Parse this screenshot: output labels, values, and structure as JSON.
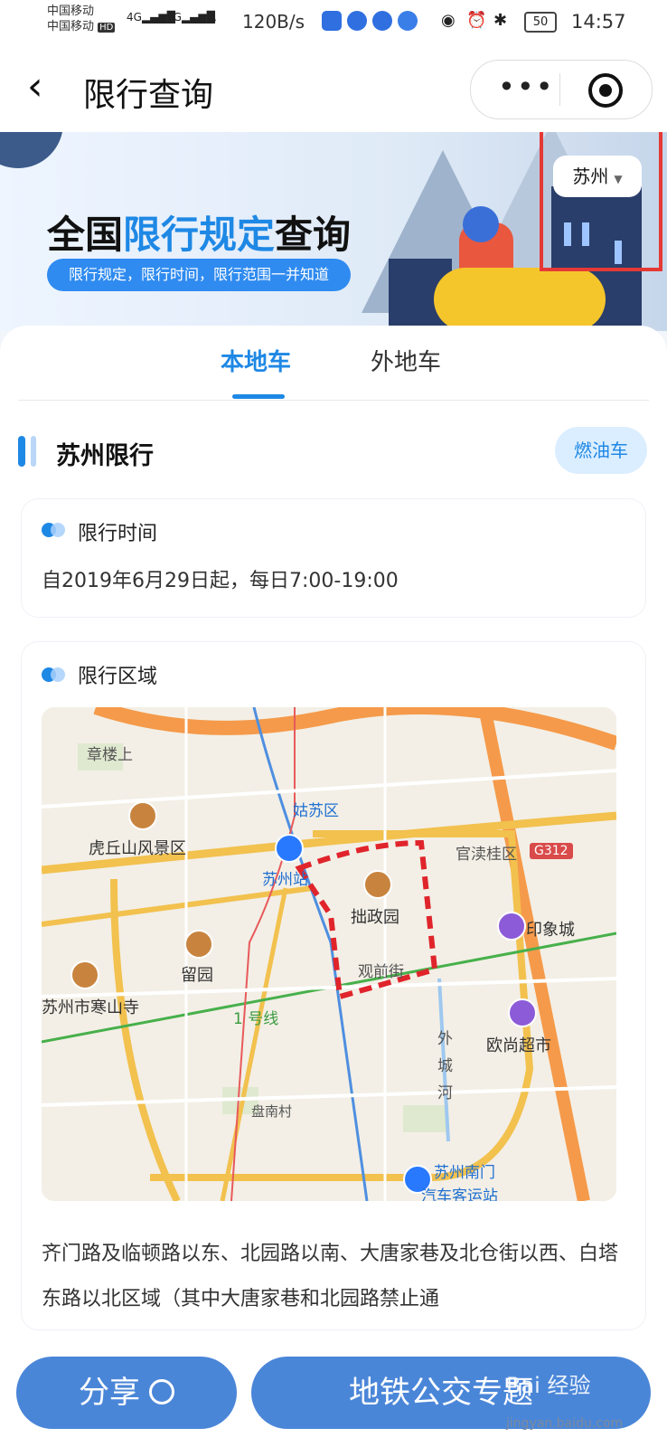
{
  "status_bar": {
    "carrier_1": "中国移动",
    "carrier_2": "中国移动",
    "hd": "HD",
    "net_1": "4G",
    "net_2": "4G",
    "speed": "120B/s",
    "battery": "50",
    "time": "14:57"
  },
  "nav": {
    "title": "限行查询",
    "back_icon": "chevron-left",
    "more_icon": "more-dots",
    "target_icon": "target"
  },
  "banner": {
    "title_part1": "全国",
    "title_highlight": "限行规定",
    "title_part2": "查询",
    "subtitle": "限行规定，限行时间，限行范围一并知道",
    "city": "苏州"
  },
  "tabs": [
    {
      "label": "本地车",
      "active": true
    },
    {
      "label": "外地车",
      "active": false
    }
  ],
  "section": {
    "title": "苏州限行",
    "fuel_label": "燃油车"
  },
  "time_box": {
    "title": "限行时间",
    "text": "自2019年6月29日起，每日7:00-19:00"
  },
  "region_box": {
    "title": "限行区域",
    "text": "齐门路及临顿路以东、北园路以南、大唐家巷及北仓街以西、白塔东路以北区域（其中大唐家巷和北园路禁止通"
  },
  "map_labels": {
    "zhangdongshang": "章楼上",
    "gusu": "姑苏区",
    "huqiu": "虎丘山风景区",
    "suzhou_station": "苏州站",
    "guanduqu": "官渎桂区",
    "g312": "G312",
    "zhuozheng": "拙政园",
    "yinxiang": "印象城",
    "liuyuan": "留园",
    "guanqian": "观前街",
    "hanshan": "苏州市寒山寺",
    "line1": "1 号线",
    "ouchang": "欧尚超市",
    "waicheng_1": "外",
    "waicheng_2": "城",
    "waicheng_3": "河",
    "pannan": "盘南村",
    "south_gate": "苏州南门",
    "bus_station": "汽车客运站"
  },
  "bottom": {
    "share": "分享",
    "metro": "地铁公交专题",
    "watermark": "Bai 经验",
    "watermark_url": "jingyan.baidu.com"
  },
  "colors": {
    "accent": "#1e88e5",
    "button": "#4a86d8",
    "highlight_box": "#e53935",
    "restricted_zone": "#e0242b"
  }
}
